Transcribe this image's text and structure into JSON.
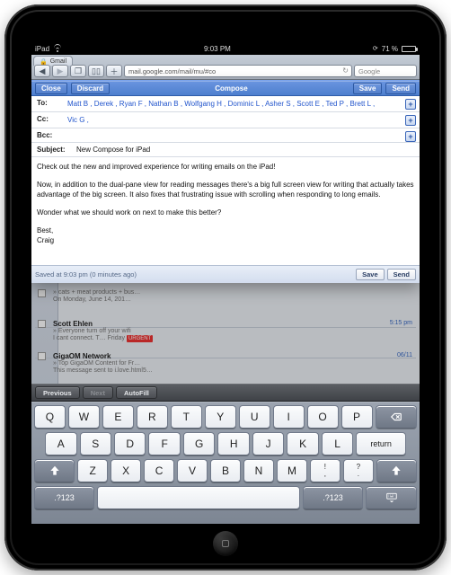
{
  "status": {
    "carrier": "iPad",
    "time": "9:03 PM",
    "battery_pct": "71 %"
  },
  "browser": {
    "tab_label": "Gmail",
    "url": "mail.google.com/mail/mu/#co",
    "search_placeholder": "Google",
    "buttons": {
      "back": "◀",
      "fwd": "▶",
      "pages": "❐",
      "bookmarks": "📖",
      "add": "＋",
      "reload": "↻"
    }
  },
  "header": {
    "close": "Close",
    "discard": "Discard",
    "title": "Compose",
    "save": "Save",
    "send": "Send"
  },
  "fields": {
    "to_label": "To:",
    "cc_label": "Cc:",
    "bcc_label": "Bcc:",
    "subject_label": "Subject:",
    "to_value": "Matt B , Derek , Ryan F , Nathan B , Wolfgang H , Dominic L , Asher S , Scott E , Ted P , Brett L ,",
    "cc_value": "Vic G ,",
    "bcc_value": "",
    "subject_value": "New Compose for iPad"
  },
  "body": {
    "p1": "Check out the new and improved experience for writing emails on the iPad!",
    "p2": "Now, in addition to the dual-pane view for reading messages there's a big full screen view for writing that actually takes advantage of the big screen. It also fixes that frustrating issue with scrolling when responding to long emails.",
    "p3": "Wonder what we should work on next to make this better?",
    "sig1": "Best,",
    "sig2": "Craig"
  },
  "footer": {
    "status": "Saved at 9:03 pm (0 minutes ago)",
    "save": "Save",
    "send": "Send"
  },
  "bg_list": {
    "item1": {
      "sender": "",
      "time": "",
      "line1": "» cats + meat products + bus…",
      "line2": "On Monday, June 14, 201…"
    },
    "item2": {
      "sender": "Scott Ehlen",
      "time": "5:15 pm",
      "line1": "» Everyone turn off your wifi",
      "line2": "I cant connect. T…  Friday",
      "urgent": "URGENT"
    },
    "item3": {
      "sender": "GigaOM Network",
      "time": "06/11",
      "line1": "» Top GigaOM Content for Fr…",
      "line2": "This message sent to i.love.html5…"
    }
  },
  "assist": {
    "prev": "Previous",
    "next": "Next",
    "autofill": "AutoFill"
  },
  "keys": {
    "row1": [
      "Q",
      "W",
      "E",
      "R",
      "T",
      "Y",
      "U",
      "I",
      "O",
      "P"
    ],
    "row2": [
      "A",
      "S",
      "D",
      "F",
      "G",
      "H",
      "J",
      "K",
      "L"
    ],
    "row3": [
      "Z",
      "X",
      "C",
      "V",
      "B",
      "N",
      "M"
    ],
    "punct1": "!\n,",
    "punct2": "?\n.",
    "numkey": ".?123",
    "return": "return"
  }
}
